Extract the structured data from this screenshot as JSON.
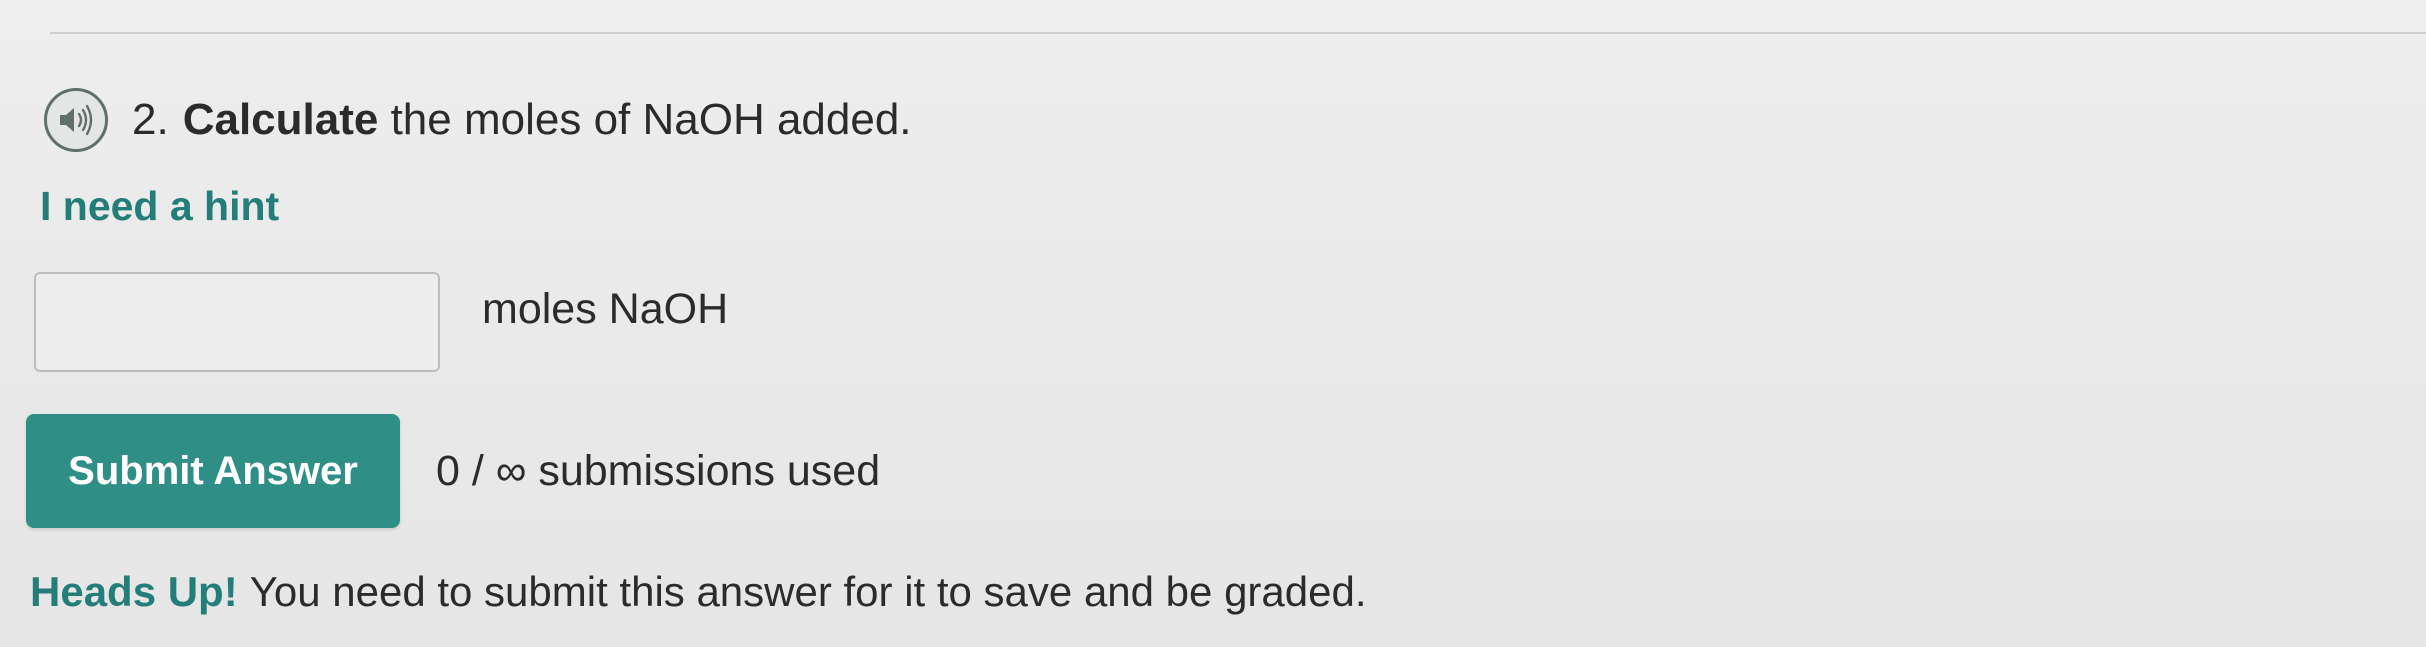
{
  "question": {
    "number": "2.",
    "bold_word": "Calculate",
    "rest_text": "the moles of NaOH added.",
    "audio_icon": "speaker-icon"
  },
  "hint": {
    "label": "I need a hint"
  },
  "answer": {
    "value": "",
    "placeholder": "",
    "units": "moles NaOH"
  },
  "submit": {
    "label": "Submit Answer",
    "submissions_text": "0 / ∞ submissions used"
  },
  "notice": {
    "label": "Heads Up!",
    "text": "You need to submit this answer for it to save and be graded."
  },
  "colors": {
    "accent": "#2f8f87",
    "link": "#237d78",
    "background": "#ececec"
  }
}
